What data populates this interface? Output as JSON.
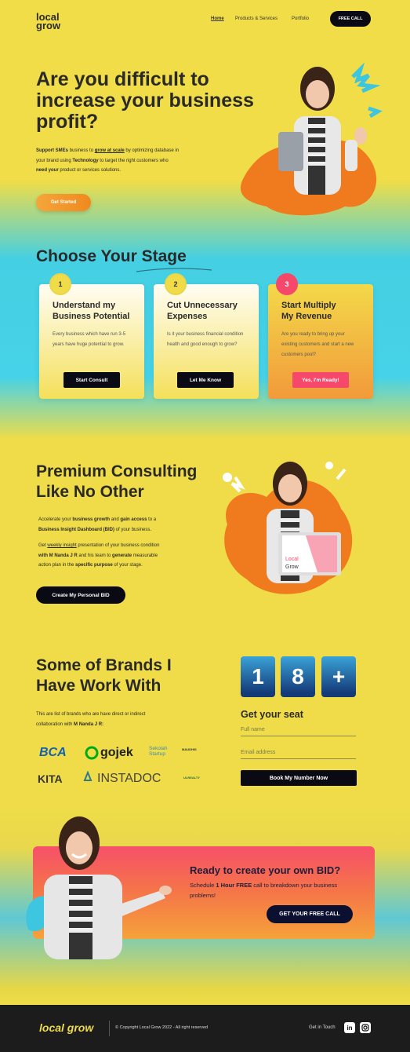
{
  "header": {
    "logo_line1": "local",
    "logo_line2": "grow",
    "nav": [
      "Home",
      "Products & Services",
      "Portfolio"
    ],
    "cta": "FREE CALL"
  },
  "hero": {
    "title": "Are you difficult to increase your business profit?",
    "p1_a": "Support SMEs",
    "p1_b": " business to ",
    "p1_c": "grow at scale",
    "p1_d": " by optimizing database in",
    "p2_a": "your brand using ",
    "p2_b": "Technology",
    "p2_c": " to target the right customers who",
    "p3_a": "need your",
    "p3_b": " product or services solutions.",
    "button": "Get Started"
  },
  "stages": {
    "title": "Choose Your Stage",
    "cards": [
      {
        "num": "1",
        "title1": "Understand my",
        "title2": "Business Potential",
        "desc": "Every business which have run 3-5 years have huge potential to grow.",
        "button": "Start Consult"
      },
      {
        "num": "2",
        "title1": "Cut Unnecessary",
        "title2": "Expenses",
        "desc": "Is it your business financial condition health and good enough to grow?",
        "button": "Let Me Know"
      },
      {
        "num": "3",
        "title1": "Start Multiply",
        "title2": "My Revenue",
        "desc": "Are you ready to bring up your existing customers and start a new customers pool?",
        "button": "Yes, I'm Ready!"
      }
    ]
  },
  "premium": {
    "title1": "Premium Consulting",
    "title2": "Like No Other",
    "p1_a": "Accelerate your ",
    "p1_b": "business growth",
    "p1_c": " and ",
    "p1_d": "gain access",
    "p1_e": " to a",
    "p2": "Business Insight Dashboard (BID)",
    "p2_b": " of your business.",
    "p3_a": "Get ",
    "p3_b": "weekly insight",
    "p3_c": " presentation of your business condition",
    "p4_a": "with M Nanda J R",
    "p4_b": " and his team to ",
    "p4_c": "generate",
    "p4_d": " measurable",
    "p5_a": "action plan in the ",
    "p5_b": "specific purpose",
    "p5_c": " of your stage.",
    "button": "Create My Personal BID",
    "laptop_text1": "Local",
    "laptop_text2": "Grow"
  },
  "brands": {
    "title1": "Some of Brands I",
    "title2": "Have Work With",
    "desc1": "This are list of brands who are have direct or indirect",
    "desc2_a": "collaboration with ",
    "desc2_b": "M Nanda J R:",
    "logos": [
      "BCA",
      "gojek",
      "Sekolah Startup",
      "MAUDHIS",
      "KITA",
      "INSTADOC",
      "ULREALTY"
    ]
  },
  "seat": {
    "digits": [
      "1",
      "8",
      "+"
    ],
    "title": "Get your seat",
    "name_placeholder": "Full name",
    "email_placeholder": "Email address",
    "button": "Book My Number Now"
  },
  "cta": {
    "title": "Ready to create your own BID?",
    "sub_a": "Schedule ",
    "sub_b": "1 Hour FREE",
    "sub_c": " call to breakdown your business",
    "sub_d": "problems!",
    "button": "GET YOUR FREE CALL"
  },
  "footer": {
    "logo": "local grow",
    "copyright": "© Copyright Local Grow 2022 - All right reserved",
    "get_in_touch": "Get in Touch",
    "icons": [
      "linkedin-icon",
      "instagram-icon"
    ]
  },
  "colors": {
    "yellow": "#f0dc48",
    "cyan": "#46d2e8",
    "dark": "#0a0a14",
    "orange": "#f0891f",
    "pink": "#f7506a"
  }
}
